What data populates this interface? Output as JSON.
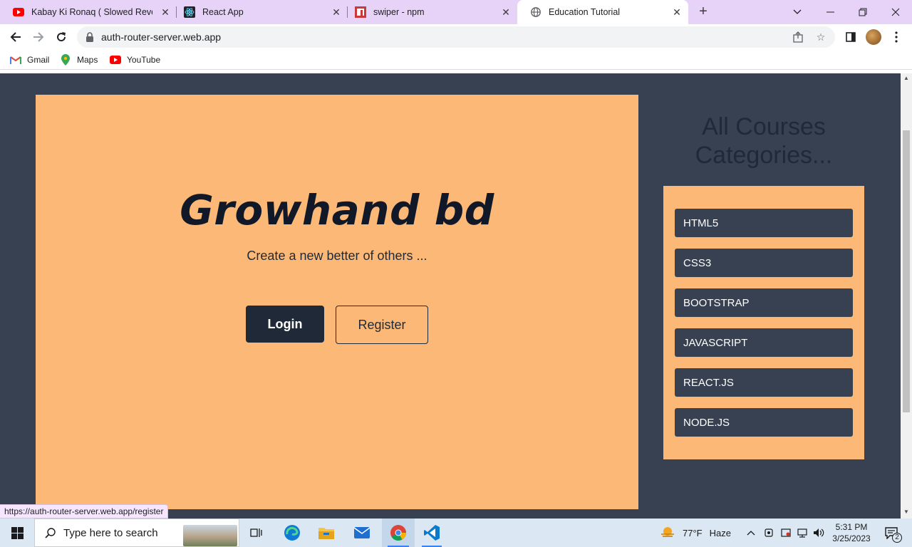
{
  "browser": {
    "tabs": [
      {
        "title": "Kabay Ki Ronaq ( Slowed Reverb",
        "icon": "youtube-icon"
      },
      {
        "title": "React App",
        "icon": "react-icon"
      },
      {
        "title": "swiper - npm",
        "icon": "npm-icon"
      },
      {
        "title": "Education Tutorial",
        "icon": "globe-icon",
        "active": true
      }
    ],
    "url": "auth-router-server.web.app",
    "bookmarks": [
      {
        "label": "Gmail",
        "icon": "gmail-icon"
      },
      {
        "label": "Maps",
        "icon": "maps-icon"
      },
      {
        "label": "YouTube",
        "icon": "youtube-icon"
      }
    ],
    "status_url": "https://auth-router-server.web.app/register"
  },
  "page": {
    "hero": {
      "title": "Growhand bd",
      "subtitle": "Create a new better of others ...",
      "login_label": "Login",
      "register_label": "Register"
    },
    "sidebar": {
      "title_line1": "All Courses",
      "title_line2": "Categories...",
      "categories": [
        "HTML5",
        "CSS3",
        "BOOTSTRAP",
        "JAVASCRIPT",
        "REACT.JS",
        "NODE.JS"
      ]
    },
    "colors": {
      "page_bg": "#374151",
      "accent": "#fbb877",
      "dark": "#1f2937"
    }
  },
  "taskbar": {
    "search_placeholder": "Type here to search",
    "weather_temp": "77°F",
    "weather_desc": "Haze",
    "time": "5:31 PM",
    "date": "3/25/2023",
    "notification_count": "2"
  }
}
